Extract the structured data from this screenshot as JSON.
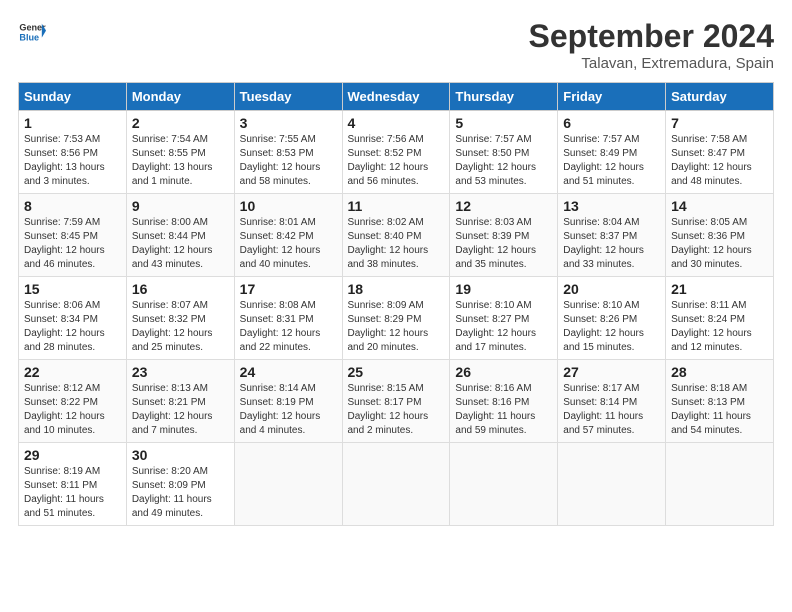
{
  "header": {
    "logo_line1": "General",
    "logo_line2": "Blue",
    "month_title": "September 2024",
    "location": "Talavan, Extremadura, Spain"
  },
  "weekdays": [
    "Sunday",
    "Monday",
    "Tuesday",
    "Wednesday",
    "Thursday",
    "Friday",
    "Saturday"
  ],
  "weeks": [
    [
      {
        "day": "1",
        "info": "Sunrise: 7:53 AM\nSunset: 8:56 PM\nDaylight: 13 hours and 3 minutes."
      },
      {
        "day": "2",
        "info": "Sunrise: 7:54 AM\nSunset: 8:55 PM\nDaylight: 13 hours and 1 minute."
      },
      {
        "day": "3",
        "info": "Sunrise: 7:55 AM\nSunset: 8:53 PM\nDaylight: 12 hours and 58 minutes."
      },
      {
        "day": "4",
        "info": "Sunrise: 7:56 AM\nSunset: 8:52 PM\nDaylight: 12 hours and 56 minutes."
      },
      {
        "day": "5",
        "info": "Sunrise: 7:57 AM\nSunset: 8:50 PM\nDaylight: 12 hours and 53 minutes."
      },
      {
        "day": "6",
        "info": "Sunrise: 7:57 AM\nSunset: 8:49 PM\nDaylight: 12 hours and 51 minutes."
      },
      {
        "day": "7",
        "info": "Sunrise: 7:58 AM\nSunset: 8:47 PM\nDaylight: 12 hours and 48 minutes."
      }
    ],
    [
      {
        "day": "8",
        "info": "Sunrise: 7:59 AM\nSunset: 8:45 PM\nDaylight: 12 hours and 46 minutes."
      },
      {
        "day": "9",
        "info": "Sunrise: 8:00 AM\nSunset: 8:44 PM\nDaylight: 12 hours and 43 minutes."
      },
      {
        "day": "10",
        "info": "Sunrise: 8:01 AM\nSunset: 8:42 PM\nDaylight: 12 hours and 40 minutes."
      },
      {
        "day": "11",
        "info": "Sunrise: 8:02 AM\nSunset: 8:40 PM\nDaylight: 12 hours and 38 minutes."
      },
      {
        "day": "12",
        "info": "Sunrise: 8:03 AM\nSunset: 8:39 PM\nDaylight: 12 hours and 35 minutes."
      },
      {
        "day": "13",
        "info": "Sunrise: 8:04 AM\nSunset: 8:37 PM\nDaylight: 12 hours and 33 minutes."
      },
      {
        "day": "14",
        "info": "Sunrise: 8:05 AM\nSunset: 8:36 PM\nDaylight: 12 hours and 30 minutes."
      }
    ],
    [
      {
        "day": "15",
        "info": "Sunrise: 8:06 AM\nSunset: 8:34 PM\nDaylight: 12 hours and 28 minutes."
      },
      {
        "day": "16",
        "info": "Sunrise: 8:07 AM\nSunset: 8:32 PM\nDaylight: 12 hours and 25 minutes."
      },
      {
        "day": "17",
        "info": "Sunrise: 8:08 AM\nSunset: 8:31 PM\nDaylight: 12 hours and 22 minutes."
      },
      {
        "day": "18",
        "info": "Sunrise: 8:09 AM\nSunset: 8:29 PM\nDaylight: 12 hours and 20 minutes."
      },
      {
        "day": "19",
        "info": "Sunrise: 8:10 AM\nSunset: 8:27 PM\nDaylight: 12 hours and 17 minutes."
      },
      {
        "day": "20",
        "info": "Sunrise: 8:10 AM\nSunset: 8:26 PM\nDaylight: 12 hours and 15 minutes."
      },
      {
        "day": "21",
        "info": "Sunrise: 8:11 AM\nSunset: 8:24 PM\nDaylight: 12 hours and 12 minutes."
      }
    ],
    [
      {
        "day": "22",
        "info": "Sunrise: 8:12 AM\nSunset: 8:22 PM\nDaylight: 12 hours and 10 minutes."
      },
      {
        "day": "23",
        "info": "Sunrise: 8:13 AM\nSunset: 8:21 PM\nDaylight: 12 hours and 7 minutes."
      },
      {
        "day": "24",
        "info": "Sunrise: 8:14 AM\nSunset: 8:19 PM\nDaylight: 12 hours and 4 minutes."
      },
      {
        "day": "25",
        "info": "Sunrise: 8:15 AM\nSunset: 8:17 PM\nDaylight: 12 hours and 2 minutes."
      },
      {
        "day": "26",
        "info": "Sunrise: 8:16 AM\nSunset: 8:16 PM\nDaylight: 11 hours and 59 minutes."
      },
      {
        "day": "27",
        "info": "Sunrise: 8:17 AM\nSunset: 8:14 PM\nDaylight: 11 hours and 57 minutes."
      },
      {
        "day": "28",
        "info": "Sunrise: 8:18 AM\nSunset: 8:13 PM\nDaylight: 11 hours and 54 minutes."
      }
    ],
    [
      {
        "day": "29",
        "info": "Sunrise: 8:19 AM\nSunset: 8:11 PM\nDaylight: 11 hours and 51 minutes."
      },
      {
        "day": "30",
        "info": "Sunrise: 8:20 AM\nSunset: 8:09 PM\nDaylight: 11 hours and 49 minutes."
      },
      {
        "day": "",
        "info": ""
      },
      {
        "day": "",
        "info": ""
      },
      {
        "day": "",
        "info": ""
      },
      {
        "day": "",
        "info": ""
      },
      {
        "day": "",
        "info": ""
      }
    ]
  ]
}
